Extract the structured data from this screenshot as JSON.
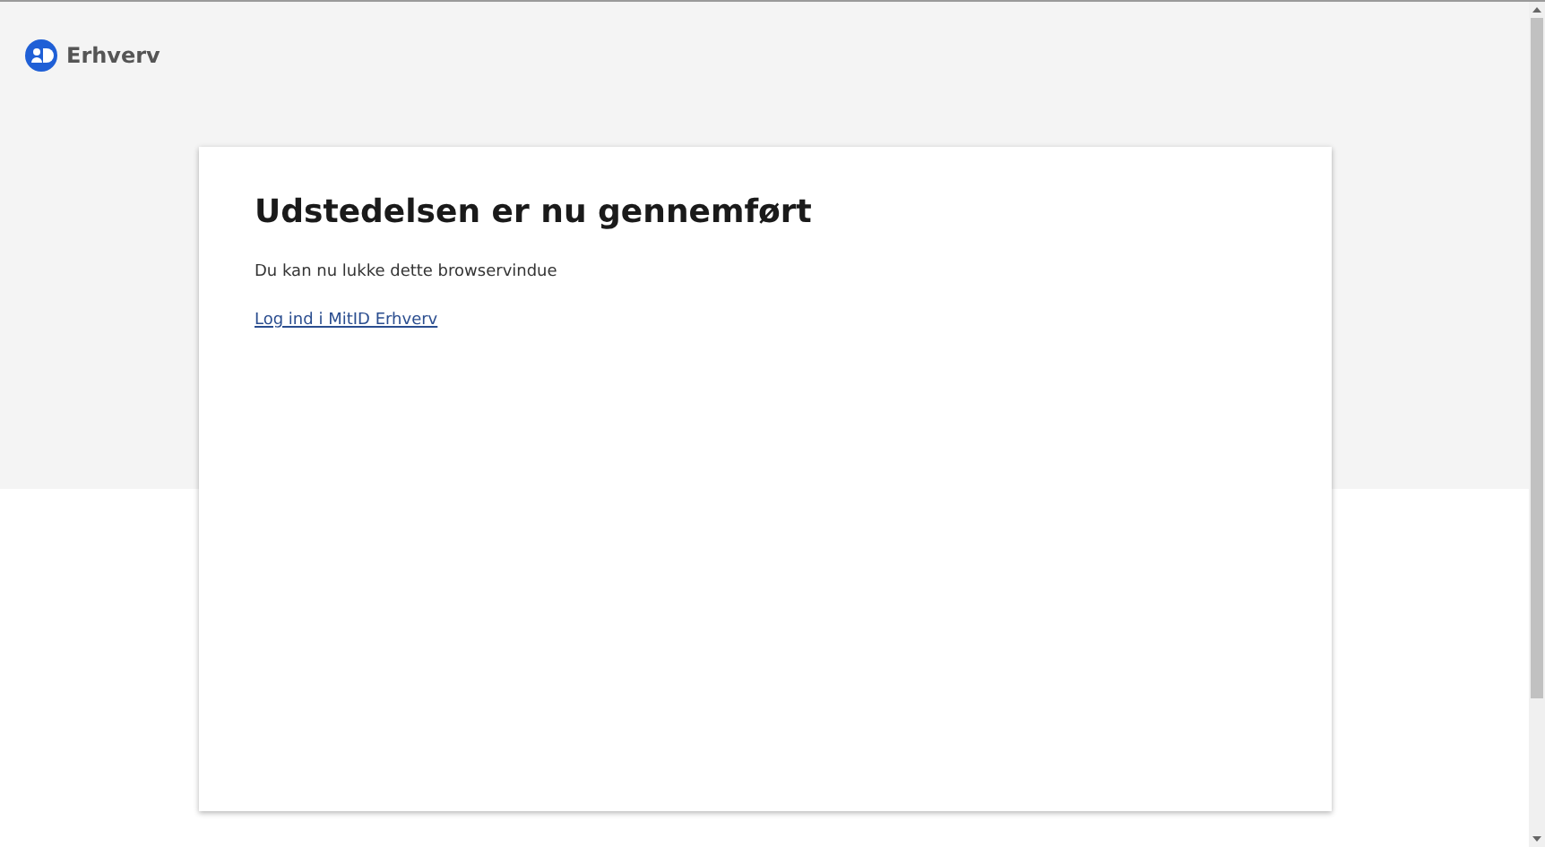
{
  "header": {
    "brand": "Erhverv"
  },
  "card": {
    "title": "Udstedelsen er nu gennemført",
    "message": "Du kan nu lukke dette browservindue",
    "link": "Log ind i MitID Erhverv"
  }
}
